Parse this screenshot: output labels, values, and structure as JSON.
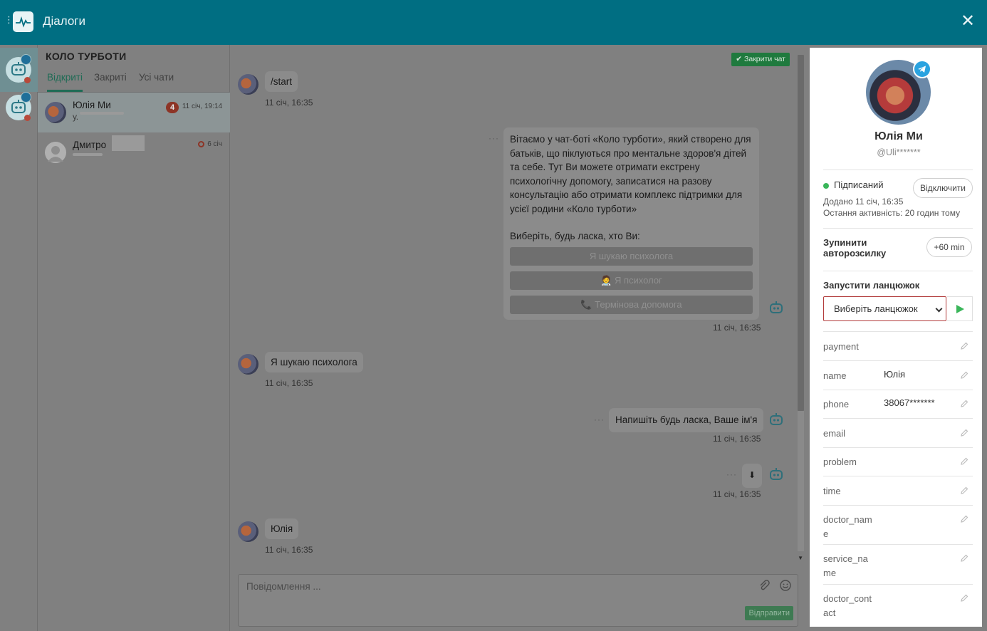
{
  "header": {
    "title": "Діалоги"
  },
  "chat_list": {
    "title": "КОЛО ТУРБОТИ",
    "tabs": [
      {
        "label": "Відкриті"
      },
      {
        "label": "Закриті"
      },
      {
        "label": "Усі чати"
      }
    ],
    "chats": [
      {
        "name": "Юлія Ми",
        "preview": "у.",
        "unread": "4",
        "time": "11 січ, 19:14"
      },
      {
        "name": "Дмитро",
        "time": "6 січ"
      }
    ]
  },
  "conversation": {
    "close_chat_label": "Закрити чат",
    "messages": [
      {
        "text": "/start",
        "time": "11 січ, 16:35"
      },
      {
        "text": "Вітаємо у чат-боті «Коло турботи», який створено для батьків, що піклуються про ментальне здоров'я дітей та себе. Тут Ви можете отримати екстрену психологічну допомогу, записатися на разову консультацію або отримати комплекс підтримки для усієї родини «Коло турботи»",
        "prompt": "Виберіть, будь ласка, хто Ви:",
        "buttons": [
          "Я шукаю психолога",
          "🧑‍⚕️ Я психолог",
          "📞 Термінова допомога"
        ],
        "time": "11 січ, 16:35"
      },
      {
        "text": "Я шукаю психолога",
        "time": "11 січ, 16:35"
      },
      {
        "text": "Напишіть будь ласка, Ваше ім'я",
        "time": "11 січ, 16:35"
      },
      {
        "text": "⬇",
        "time": "11 січ, 16:35"
      },
      {
        "text": "Юлія",
        "time": "11 січ, 16:35"
      }
    ],
    "composer": {
      "placeholder": "Повідомлення ...",
      "send_label": "Відправити"
    }
  },
  "profile": {
    "name": "Юлія Ми",
    "username": "@Uli*******",
    "status": "Підписаний",
    "disconnect_label": "Відключити",
    "added": "Додано 11 січ, 16:35",
    "last_active": "Остання активність: 20 годин тому",
    "stop_autosend_label": "Зупинити авторозсилку",
    "plus_60_label": "+60 min",
    "chain_label": "Запустити ланцюжок",
    "chain_select": "Виберіть ланцюжок",
    "fields": [
      {
        "key": "payment",
        "value": ""
      },
      {
        "key": "name",
        "value": "Юлія"
      },
      {
        "key": "phone",
        "value": "38067*******"
      },
      {
        "key": "email",
        "value": ""
      },
      {
        "key": "problem",
        "value": ""
      },
      {
        "key": "time",
        "value": ""
      },
      {
        "key": "doctor_name",
        "value": ""
      },
      {
        "key": "service_name",
        "value": ""
      },
      {
        "key": "doctor_contact",
        "value": ""
      }
    ]
  },
  "colors": {
    "topbar": "#006e82",
    "overlay_gray": "#808080",
    "accent_green": "#3ab65a",
    "badge_red": "#8d3426",
    "telegram_blue": "#2aa3e0"
  },
  "icons": [
    "drag-dots-icon",
    "pulse-logo-icon",
    "close-icon",
    "bot-icon",
    "telegram-icon",
    "check-icon",
    "paperclip-icon",
    "smile-icon",
    "pencil-icon",
    "play-icon",
    "chevron-down-icon"
  ]
}
